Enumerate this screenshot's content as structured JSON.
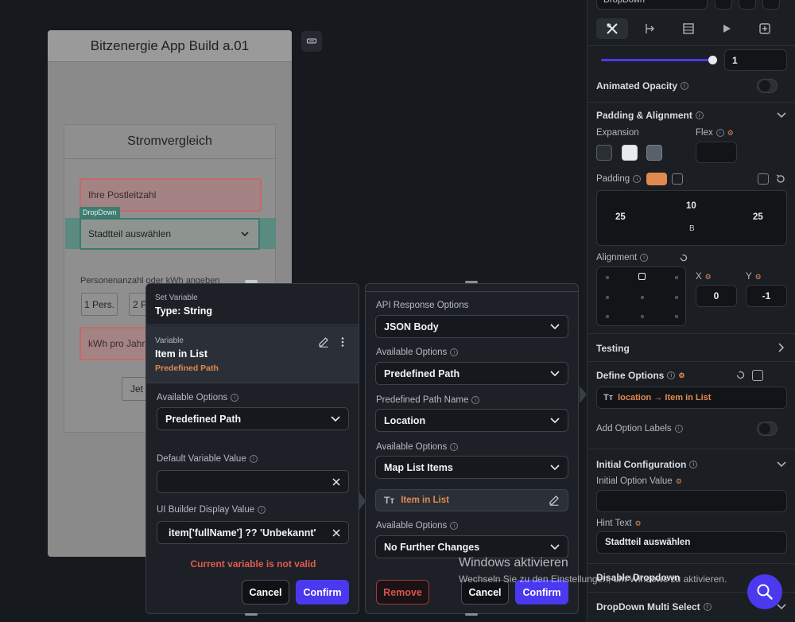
{
  "phone": {
    "title": "Bitzenergie App Build a.01",
    "card_title": "Stromvergleich",
    "postcode_placeholder": "Ihre Postleitzahl",
    "dropdown_tag": "DropDown",
    "dropdown_value": "Stadtteil auswählen",
    "persons_label": "Personenanzahl oder kWh angeben",
    "chip1": "1 Pers.",
    "chip2": "2 P",
    "kwh_placeholder": "kWh pro Jahr",
    "button_partial": "Jet"
  },
  "set_variable": {
    "header_small": "Set Variable",
    "header_type": "Type: String",
    "var_small": "Variable",
    "var_name": "Item in List",
    "var_source": "Predefined Path",
    "available_options_label": "Available Options",
    "available_options_value": "Predefined Path",
    "default_value_label": "Default Variable Value",
    "default_value": "",
    "display_value_label": "UI Builder Display Value",
    "display_value": "item['fullName'] ?? 'Unbekannt'",
    "error": "Current variable is not valid",
    "cancel": "Cancel",
    "confirm": "Confirm"
  },
  "api_panel": {
    "response_label": "API Response Options",
    "response_value": "JSON Body",
    "avail1_label": "Available Options",
    "avail1_value": "Predefined Path",
    "path_name_label": "Predefined Path Name",
    "path_name_value": "Location",
    "avail2_label": "Available Options",
    "avail2_value": "Map List Items",
    "item_chip": "Item in List",
    "avail3_label": "Available Options",
    "avail3_value": "No Further Changes",
    "remove": "Remove",
    "cancel": "Cancel",
    "confirm": "Confirm"
  },
  "right_panel": {
    "top_field": "DropDown",
    "slider_value": "1",
    "animated_opacity": "Animated Opacity",
    "padding_alignment": "Padding & Alignment",
    "expansion": "Expansion",
    "flex": "Flex",
    "padding": "Padding",
    "pad_left": "25",
    "pad_top": "10",
    "pad_right": "25",
    "pad_bottom": "B",
    "alignment": "Alignment",
    "x_label": "X",
    "y_label": "Y",
    "x_value": "0",
    "y_value": "-1",
    "testing": "Testing",
    "define_options": "Define Options",
    "define_options_value": "location → Item in List",
    "add_option_labels": "Add Option Labels",
    "initial_configuration": "Initial Configuration",
    "initial_option_value": "Initial Option Value",
    "hint_text": "Hint Text",
    "hint_value": "Stadtteil auswählen",
    "disable_dropdown": "Disable Dropdown",
    "multi_select": "DropDown Multi Select"
  },
  "watermark": {
    "title": "Windows aktivieren",
    "subtitle": "Wechseln Sie zu den Einstellungen, um Windows zu aktivieren."
  },
  "colors": {
    "accent": "#4b39ef",
    "orange": "#e08a4f",
    "error": "#e05a4f"
  }
}
